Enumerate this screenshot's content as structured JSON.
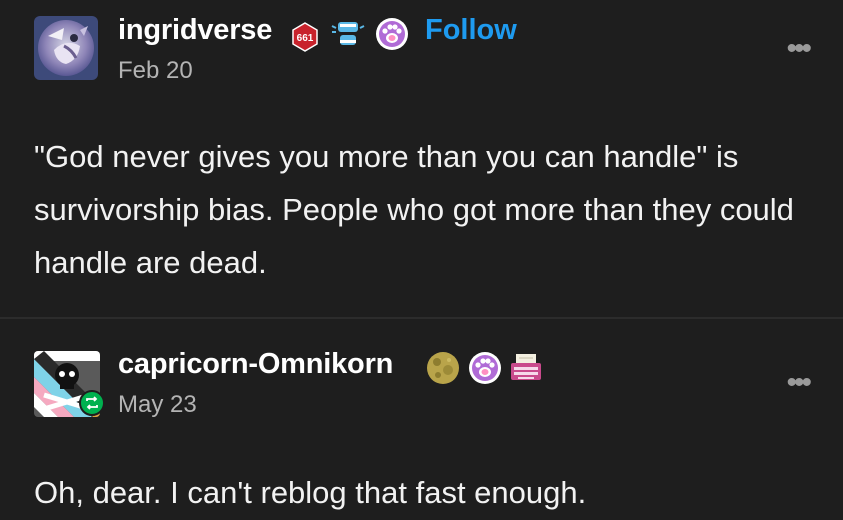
{
  "posts": [
    {
      "username": "ingridverse",
      "badge_text": "661",
      "follow_label": "Follow",
      "date": "Feb 20",
      "more_label": "•••",
      "body": "\"God never gives you more than you can handle\" is survivorship bias. People who got more than they could handle are dead."
    },
    {
      "username": "capricorn-Omnikorn",
      "date": "May 23",
      "more_label": "•••",
      "body": "Oh, dear. I can't reblog that fast enough."
    }
  ],
  "colors": {
    "background": "#1e1e1e",
    "follow": "#1e9bf0",
    "reblog_badge": "#00b14f",
    "date": "#b4b4b4"
  },
  "icons": [
    "red-hexagon-badge-icon",
    "blue-chatter-icon",
    "paw-badge-icon",
    "moon-icon",
    "typewriter-icon",
    "reblog-icon",
    "more-options-icon"
  ]
}
